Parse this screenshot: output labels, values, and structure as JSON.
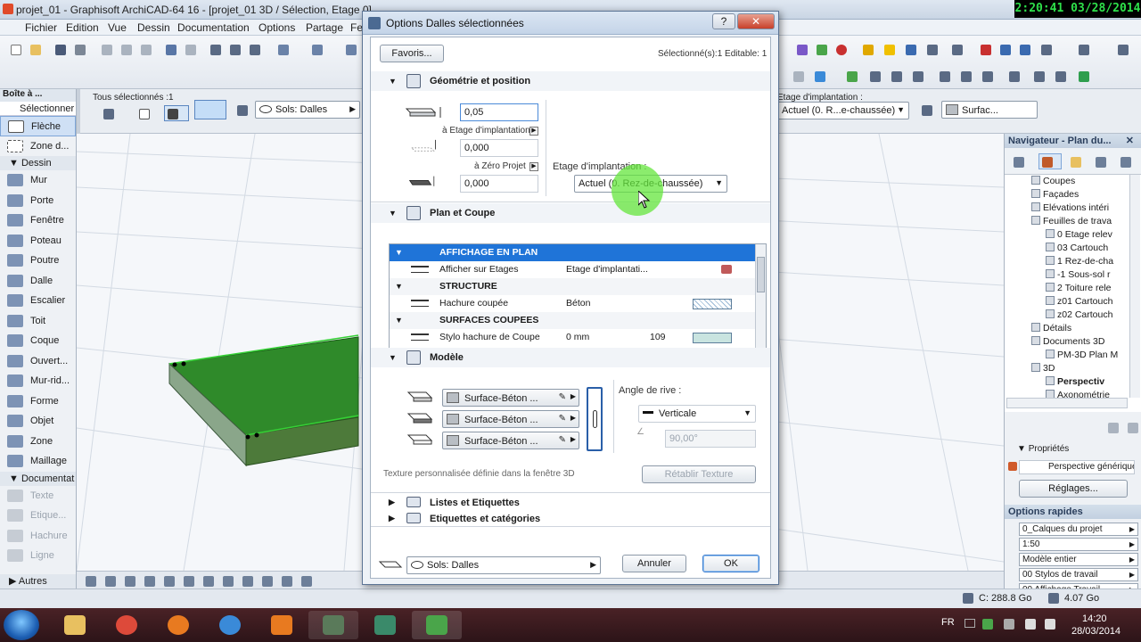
{
  "app": {
    "window_title": "projet_01 - Graphisoft ArchiCAD-64 16 - [projet_01 3D / Sélection, Etage 0]",
    "clock_overlay": "2:20:41  03/28/2014"
  },
  "menu": [
    "Fichier",
    "Edition",
    "Vue",
    "Dessin",
    "Documentation",
    "Options",
    "Partage",
    "Fe"
  ],
  "infobox": {
    "all_selected": "Tous sélectionnés :1",
    "sols_combo": "Sols: Dalles",
    "etage_label": "Etage d'implantation :",
    "etage_combo": "Actuel (0. R...e-chaussée)",
    "surface_combo": "Surfac..."
  },
  "toolbox": {
    "title": "Boîte à ...",
    "selectionner": "Sélectionner",
    "pointer_tools": [
      {
        "label": "Flèche",
        "selected": true
      },
      {
        "label": "Zone d...",
        "selected": false
      }
    ],
    "group_dessin": "Dessin",
    "dessin_tools": [
      "Mur",
      "Porte",
      "Fenêtre",
      "Poteau",
      "Poutre",
      "Dalle",
      "Escalier",
      "Toit",
      "Coque",
      "Ouvert...",
      "Mur-rid...",
      "Forme",
      "Objet",
      "Zone",
      "Maillage"
    ],
    "group_documentat": "Documentat",
    "doc_tools": [
      "Texte",
      "Etique...",
      "Hachure",
      "Ligne"
    ],
    "autres": "Autres"
  },
  "navigator": {
    "title": "Navigateur - Plan du...",
    "tree": [
      {
        "label": "Coupes",
        "indent": 30,
        "bold": false
      },
      {
        "label": "Façades",
        "indent": 30,
        "bold": false
      },
      {
        "label": "Elévations intéri",
        "indent": 30,
        "bold": false
      },
      {
        "label": "Feuilles de trava",
        "indent": 30,
        "bold": false
      },
      {
        "label": "0 Etage relev",
        "indent": 46,
        "bold": false
      },
      {
        "label": "03 Cartouch",
        "indent": 46,
        "bold": false
      },
      {
        "label": "1 Rez-de-cha",
        "indent": 46,
        "bold": false
      },
      {
        "label": "-1 Sous-sol r",
        "indent": 46,
        "bold": false
      },
      {
        "label": "2 Toiture rele",
        "indent": 46,
        "bold": false
      },
      {
        "label": "z01 Cartouch",
        "indent": 46,
        "bold": false
      },
      {
        "label": "z02 Cartouch",
        "indent": 46,
        "bold": false
      },
      {
        "label": "Détails",
        "indent": 30,
        "bold": false
      },
      {
        "label": "Documents 3D",
        "indent": 30,
        "bold": false
      },
      {
        "label": "PM-3D Plan M",
        "indent": 46,
        "bold": false
      },
      {
        "label": "3D",
        "indent": 30,
        "bold": false
      },
      {
        "label": "Perspectiv",
        "indent": 46,
        "bold": true
      },
      {
        "label": "Axonométrie",
        "indent": 46,
        "bold": false
      }
    ]
  },
  "properties": {
    "title": "Propriétés",
    "value": "Perspective générique",
    "reglages": "Réglages..."
  },
  "quick_options": {
    "title": "Options rapides",
    "rows": [
      "0_Calques du projet",
      "1:50",
      "Modèle entier",
      "00 Stylos de travail",
      "00 Affichage Travail"
    ]
  },
  "status": {
    "disk_c": "C: 288.8 Go",
    "ram": "4.07 Go"
  },
  "taskbar": {
    "lang": "FR",
    "time": "14:20",
    "date": "28/03/2014"
  },
  "dialog": {
    "title": "Options Dalles sélectionnées",
    "help": "?",
    "close": "✕",
    "favoris": "Favoris...",
    "selected_info": "Sélectionné(s):1 Editable: 1",
    "geometry": {
      "header": "Géométrie et position",
      "thickness": "0,05",
      "ref_etage": "à Etage d'implantation",
      "offset_etage": "0,000",
      "ref_zero": "à Zéro Projet",
      "offset_zero": "0,000",
      "etage_label": "Etage d'implantation :",
      "etage_value": "Actuel (0. Rez-de-chaussée)"
    },
    "plan_coupe": {
      "header": "Plan et Coupe",
      "rows": [
        {
          "type": "group",
          "label": "AFFICHAGE EN PLAN",
          "selected": true
        },
        {
          "type": "row",
          "label": "Afficher sur Etages",
          "value": "Etage d'implantati...",
          "extra": ""
        },
        {
          "type": "group",
          "label": "STRUCTURE",
          "selected": false
        },
        {
          "type": "row",
          "label": "Hachure coupée",
          "value": "Béton",
          "extra": ""
        },
        {
          "type": "group",
          "label": "SURFACES COUPEES",
          "selected": false
        },
        {
          "type": "row",
          "label": "Stylo hachure de Coupe",
          "value": "0 mm",
          "extra": "109"
        }
      ]
    },
    "modele": {
      "header": "Modèle",
      "materials": [
        "Surface-Béton ...",
        "Surface-Béton ...",
        "Surface-Béton ..."
      ],
      "angle_label": "Angle de rive :",
      "angle_type": "Verticale",
      "angle_value": "90,00°",
      "texture_note": "Texture personnalisée définie dans la fenêtre 3D",
      "reset_texture": "Rétablir Texture"
    },
    "listes": "Listes et Etiquettes",
    "etiquettes": "Etiquettes et catégories",
    "footer_layer": "Sols: Dalles",
    "cancel": "Annuler",
    "ok": "OK"
  },
  "colors": {
    "slab_green": "#2d8a2d",
    "selection_blue": "#1f74d8",
    "cursor_highlight": "#64e63c"
  }
}
